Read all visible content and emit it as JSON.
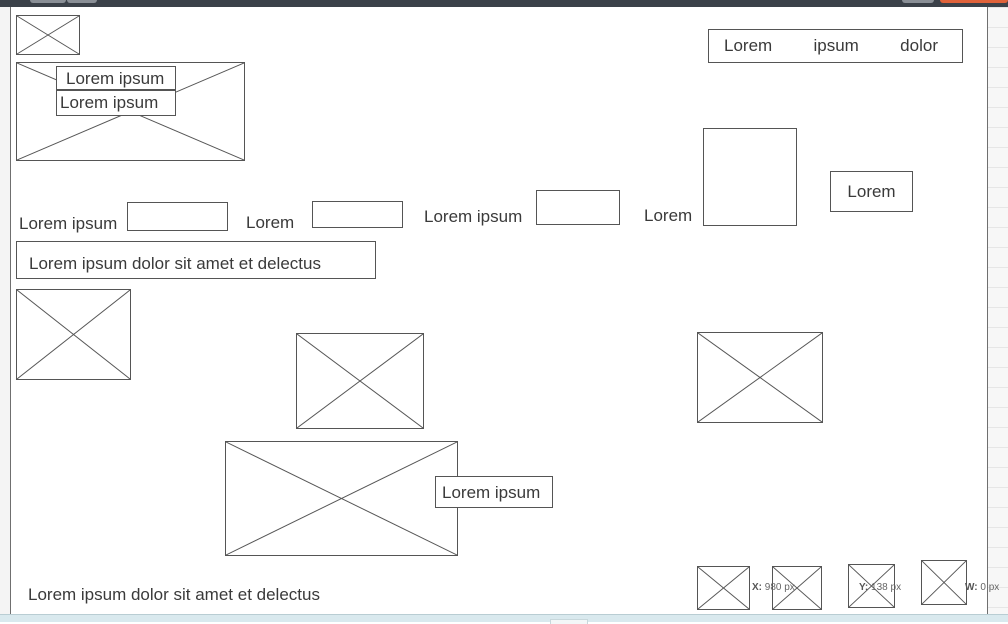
{
  "canvas": {
    "tabs": [
      "Lorem",
      "ipsum",
      "dolor"
    ],
    "overlay_labels": [
      "Lorem ipsum",
      "Lorem ipsum"
    ],
    "form": {
      "field1_label": "Lorem ipsum",
      "field2_label": "Lorem",
      "field3_label": "Lorem ipsum",
      "field4_label": "Lorem"
    },
    "button_label": "Lorem",
    "text_input_value": "Lorem ipsum dolor sit amet et delectus",
    "caption_label": "Lorem ipsum",
    "footer_text": "Lorem ipsum dolor sit amet et delectus"
  },
  "readouts": {
    "x_label": "X:",
    "x_value": "980 px",
    "y_label": "Y:",
    "y_value": "138 px",
    "w_label": "W:",
    "w_value": "0 px"
  }
}
